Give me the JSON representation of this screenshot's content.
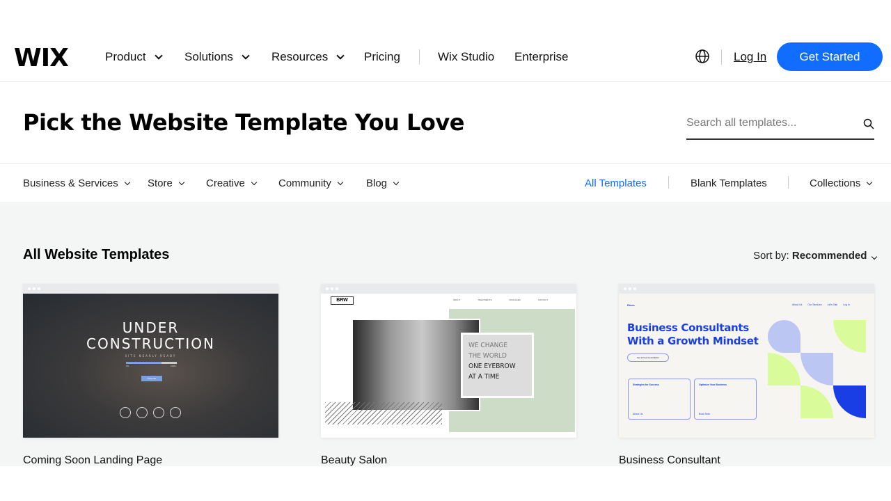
{
  "header": {
    "logo": "WIX",
    "nav": [
      "Product",
      "Solutions",
      "Resources",
      "Pricing",
      "Wix Studio",
      "Enterprise"
    ],
    "login": "Log In",
    "cta": "Get Started"
  },
  "hero": {
    "title": "Pick the Website Template You Love",
    "search_placeholder": "Search all templates..."
  },
  "categories": [
    "Business & Services",
    "Store",
    "Creative",
    "Community",
    "Blog"
  ],
  "right_links": {
    "all": "All Templates",
    "blank": "Blank Templates",
    "collections": "Collections"
  },
  "section": {
    "title": "All Website Templates",
    "sort_label": "Sort by:",
    "sort_value": "Recommended"
  },
  "templates": [
    {
      "name": "Coming Soon Landing Page",
      "l1": "UNDER",
      "l2": "CONSTRUCTION",
      "sub": "SITE NEARLY READY",
      "p0": "0%",
      "p100": "100%",
      "progress": 0.7,
      "btn": "Notify Me"
    },
    {
      "name": "Beauty Salon",
      "logo": "BRW",
      "nav": [
        "ABOUT",
        "TREATMENTS",
        "PACKAGES",
        "CONTACT"
      ],
      "l1": "WE CHANGE",
      "l2": "THE WORLD",
      "l3": "ONE EYEBROW",
      "l4": "AT A TIME"
    },
    {
      "name": "Business Consultant",
      "logo": "Rises",
      "nav": [
        "About Us",
        "Our Services",
        "Let's Talk",
        "Log In"
      ],
      "headline1": "Business Consultants",
      "headline2": "With a Growth Mindset",
      "btn": "Get a Free Consultation",
      "box1": "Strategies for Success",
      "box2": "Optimize Your Business",
      "link1": "About Us",
      "link2": "Book Now"
    }
  ],
  "colors": {
    "accent": "#116dff",
    "consult_blue": "#1a3ee6",
    "lime": "#d9fb9a",
    "lavender": "#bcc6f2",
    "sage": "#cddcc6"
  }
}
